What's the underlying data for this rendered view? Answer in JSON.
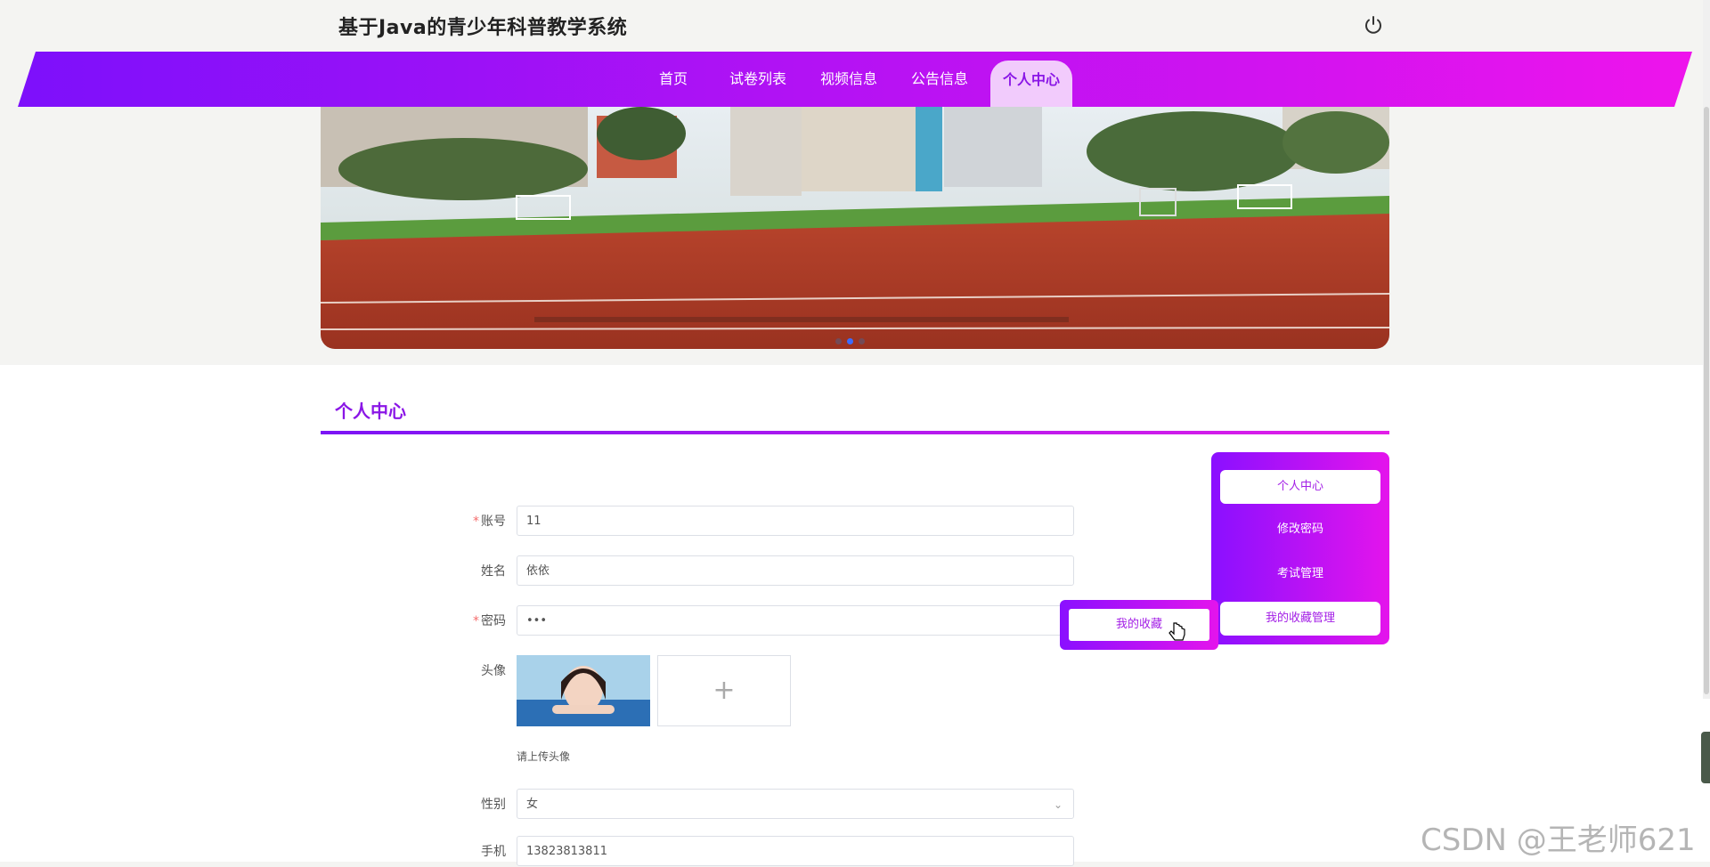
{
  "site": {
    "title": "基于Java的青少年科普教学系统"
  },
  "nav": {
    "items": [
      {
        "label": "首页"
      },
      {
        "label": "试卷列表"
      },
      {
        "label": "视频信息"
      },
      {
        "label": "公告信息"
      },
      {
        "label": "个人中心",
        "active": true
      }
    ]
  },
  "banner": {
    "active_dot": 2,
    "dot_count": 3
  },
  "section": {
    "title": "个人中心"
  },
  "form": {
    "account": {
      "label": "账号",
      "value": "11",
      "required": true
    },
    "name": {
      "label": "姓名",
      "value": "依依"
    },
    "password": {
      "label": "密码",
      "value": "•••",
      "required": true
    },
    "avatar": {
      "label": "头像",
      "hint": "请上传头像",
      "add_symbol": "+"
    },
    "gender": {
      "label": "性别",
      "value": "女"
    },
    "phone": {
      "label": "手机",
      "value": "13823813811"
    }
  },
  "sidemenu": {
    "items": [
      {
        "label": "个人中心"
      },
      {
        "label": "修改密码"
      },
      {
        "label": "考试管理"
      },
      {
        "label": "我的收藏管理"
      }
    ]
  },
  "floating": {
    "label": "我的收藏"
  },
  "watermark": "CSDN @王老师621",
  "colors": {
    "accent_start": "#7b14f5",
    "accent_end": "#e414ec",
    "accent_text": "#8a16e6"
  }
}
